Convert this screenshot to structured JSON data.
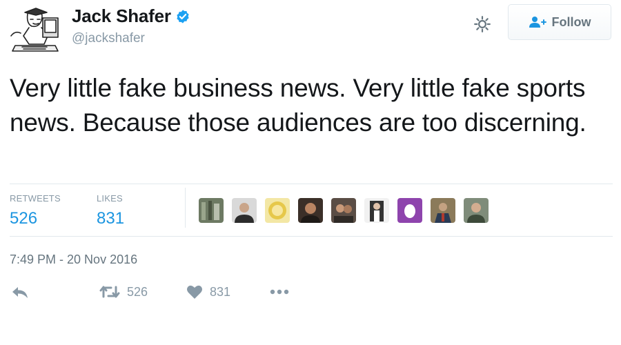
{
  "user": {
    "name": "Jack Shafer",
    "handle": "@jackshafer",
    "verified": true
  },
  "follow_button": {
    "label": "Follow",
    "icon": "add-user-icon"
  },
  "tweet": {
    "text": "Very little fake business news. Very little fake sports news. Because those audiences are too discerning."
  },
  "stats": {
    "retweets_label": "RETWEETS",
    "retweets_value": "526",
    "likes_label": "LIKES",
    "likes_value": "831"
  },
  "timestamp": "7:49 PM - 20 Nov 2016",
  "actions": {
    "reply_icon": "reply-icon",
    "retweet_count": "526",
    "like_count": "831",
    "more_icon": "more-icon"
  },
  "colors": {
    "accent": "#1b95e0",
    "muted": "#8899a6",
    "text": "#14171a",
    "border": "#e1e8ed"
  }
}
